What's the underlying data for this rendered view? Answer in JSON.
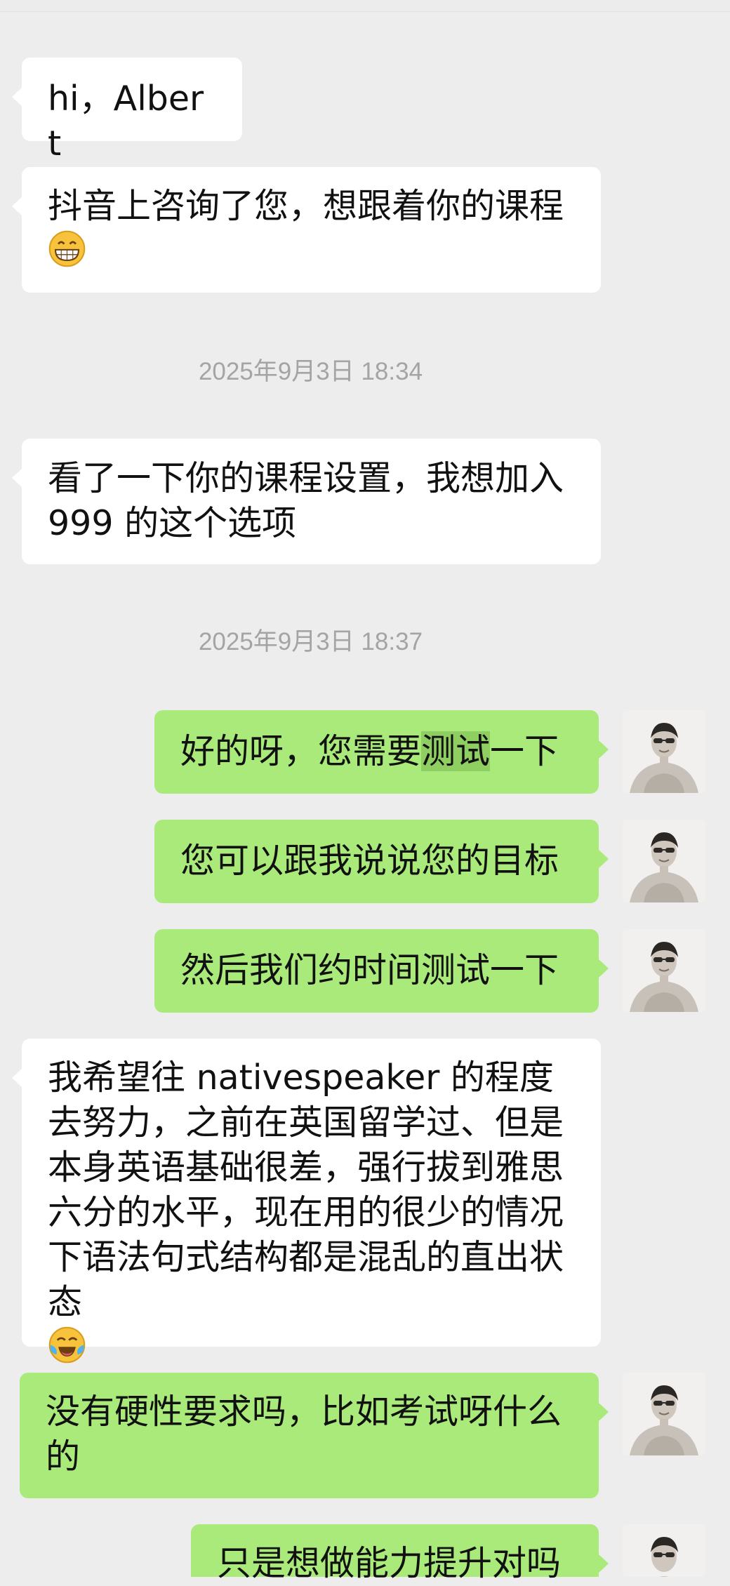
{
  "chat": {
    "messages": [
      {
        "side": "in",
        "text": "hi，Albert",
        "emoji": ""
      },
      {
        "side": "in",
        "text": "抖音上咨询了您，想跟着你的课程",
        "emoji": "grinning-face-icon"
      },
      {
        "side": "in",
        "text": "看了一下你的课程设置，我想加入999 的这个选项",
        "emoji": ""
      },
      {
        "side": "out",
        "text_before": "好的呀，您需要",
        "text_highlight": "测试",
        "text_after": "一下"
      },
      {
        "side": "out",
        "text": "您可以跟我说说您的目标"
      },
      {
        "side": "out",
        "text": "然后我们约时间测试一下"
      },
      {
        "side": "in",
        "text": "我希望往 nativespeaker 的程度去努力，之前在英国留学过、但是本身英语基础很差，强行拔到雅思六分的水平，现在用的很少的情况下语法句式结构都是混乱的直出状态",
        "emoji": "laughing-with-tears-icon"
      },
      {
        "side": "out",
        "text": "没有硬性要求吗，比如考试呀什么的"
      },
      {
        "side": "out",
        "text": "只是想做能力提升对吗"
      }
    ],
    "timestamps": [
      "2025年9月3日 18:34",
      "2025年9月3日 18:37"
    ]
  },
  "colors": {
    "background": "#ededed",
    "incoming_bubble": "#ffffff",
    "outgoing_bubble": "#a9ea7a",
    "timestamp_text": "#a4a4a4",
    "highlight": "#8fcf62"
  }
}
